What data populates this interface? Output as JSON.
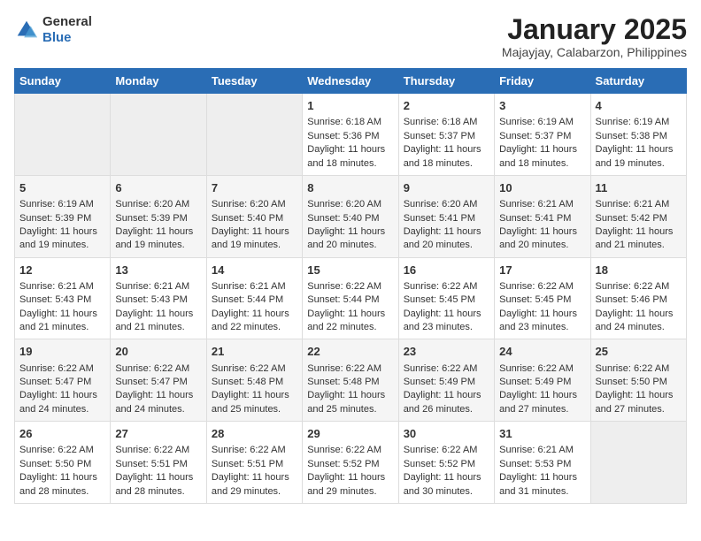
{
  "header": {
    "logo": {
      "general": "General",
      "blue": "Blue"
    },
    "title": "January 2025",
    "subtitle": "Majayjay, Calabarzon, Philippines"
  },
  "calendar": {
    "days_of_week": [
      "Sunday",
      "Monday",
      "Tuesday",
      "Wednesday",
      "Thursday",
      "Friday",
      "Saturday"
    ],
    "weeks": [
      [
        {
          "day": "",
          "data": ""
        },
        {
          "day": "",
          "data": ""
        },
        {
          "day": "",
          "data": ""
        },
        {
          "day": "1",
          "data": "Sunrise: 6:18 AM\nSunset: 5:36 PM\nDaylight: 11 hours\nand 18 minutes."
        },
        {
          "day": "2",
          "data": "Sunrise: 6:18 AM\nSunset: 5:37 PM\nDaylight: 11 hours\nand 18 minutes."
        },
        {
          "day": "3",
          "data": "Sunrise: 6:19 AM\nSunset: 5:37 PM\nDaylight: 11 hours\nand 18 minutes."
        },
        {
          "day": "4",
          "data": "Sunrise: 6:19 AM\nSunset: 5:38 PM\nDaylight: 11 hours\nand 19 minutes."
        }
      ],
      [
        {
          "day": "5",
          "data": "Sunrise: 6:19 AM\nSunset: 5:39 PM\nDaylight: 11 hours\nand 19 minutes."
        },
        {
          "day": "6",
          "data": "Sunrise: 6:20 AM\nSunset: 5:39 PM\nDaylight: 11 hours\nand 19 minutes."
        },
        {
          "day": "7",
          "data": "Sunrise: 6:20 AM\nSunset: 5:40 PM\nDaylight: 11 hours\nand 19 minutes."
        },
        {
          "day": "8",
          "data": "Sunrise: 6:20 AM\nSunset: 5:40 PM\nDaylight: 11 hours\nand 20 minutes."
        },
        {
          "day": "9",
          "data": "Sunrise: 6:20 AM\nSunset: 5:41 PM\nDaylight: 11 hours\nand 20 minutes."
        },
        {
          "day": "10",
          "data": "Sunrise: 6:21 AM\nSunset: 5:41 PM\nDaylight: 11 hours\nand 20 minutes."
        },
        {
          "day": "11",
          "data": "Sunrise: 6:21 AM\nSunset: 5:42 PM\nDaylight: 11 hours\nand 21 minutes."
        }
      ],
      [
        {
          "day": "12",
          "data": "Sunrise: 6:21 AM\nSunset: 5:43 PM\nDaylight: 11 hours\nand 21 minutes."
        },
        {
          "day": "13",
          "data": "Sunrise: 6:21 AM\nSunset: 5:43 PM\nDaylight: 11 hours\nand 21 minutes."
        },
        {
          "day": "14",
          "data": "Sunrise: 6:21 AM\nSunset: 5:44 PM\nDaylight: 11 hours\nand 22 minutes."
        },
        {
          "day": "15",
          "data": "Sunrise: 6:22 AM\nSunset: 5:44 PM\nDaylight: 11 hours\nand 22 minutes."
        },
        {
          "day": "16",
          "data": "Sunrise: 6:22 AM\nSunset: 5:45 PM\nDaylight: 11 hours\nand 23 minutes."
        },
        {
          "day": "17",
          "data": "Sunrise: 6:22 AM\nSunset: 5:45 PM\nDaylight: 11 hours\nand 23 minutes."
        },
        {
          "day": "18",
          "data": "Sunrise: 6:22 AM\nSunset: 5:46 PM\nDaylight: 11 hours\nand 24 minutes."
        }
      ],
      [
        {
          "day": "19",
          "data": "Sunrise: 6:22 AM\nSunset: 5:47 PM\nDaylight: 11 hours\nand 24 minutes."
        },
        {
          "day": "20",
          "data": "Sunrise: 6:22 AM\nSunset: 5:47 PM\nDaylight: 11 hours\nand 24 minutes."
        },
        {
          "day": "21",
          "data": "Sunrise: 6:22 AM\nSunset: 5:48 PM\nDaylight: 11 hours\nand 25 minutes."
        },
        {
          "day": "22",
          "data": "Sunrise: 6:22 AM\nSunset: 5:48 PM\nDaylight: 11 hours\nand 25 minutes."
        },
        {
          "day": "23",
          "data": "Sunrise: 6:22 AM\nSunset: 5:49 PM\nDaylight: 11 hours\nand 26 minutes."
        },
        {
          "day": "24",
          "data": "Sunrise: 6:22 AM\nSunset: 5:49 PM\nDaylight: 11 hours\nand 27 minutes."
        },
        {
          "day": "25",
          "data": "Sunrise: 6:22 AM\nSunset: 5:50 PM\nDaylight: 11 hours\nand 27 minutes."
        }
      ],
      [
        {
          "day": "26",
          "data": "Sunrise: 6:22 AM\nSunset: 5:50 PM\nDaylight: 11 hours\nand 28 minutes."
        },
        {
          "day": "27",
          "data": "Sunrise: 6:22 AM\nSunset: 5:51 PM\nDaylight: 11 hours\nand 28 minutes."
        },
        {
          "day": "28",
          "data": "Sunrise: 6:22 AM\nSunset: 5:51 PM\nDaylight: 11 hours\nand 29 minutes."
        },
        {
          "day": "29",
          "data": "Sunrise: 6:22 AM\nSunset: 5:52 PM\nDaylight: 11 hours\nand 29 minutes."
        },
        {
          "day": "30",
          "data": "Sunrise: 6:22 AM\nSunset: 5:52 PM\nDaylight: 11 hours\nand 30 minutes."
        },
        {
          "day": "31",
          "data": "Sunrise: 6:21 AM\nSunset: 5:53 PM\nDaylight: 11 hours\nand 31 minutes."
        },
        {
          "day": "",
          "data": ""
        }
      ]
    ]
  }
}
